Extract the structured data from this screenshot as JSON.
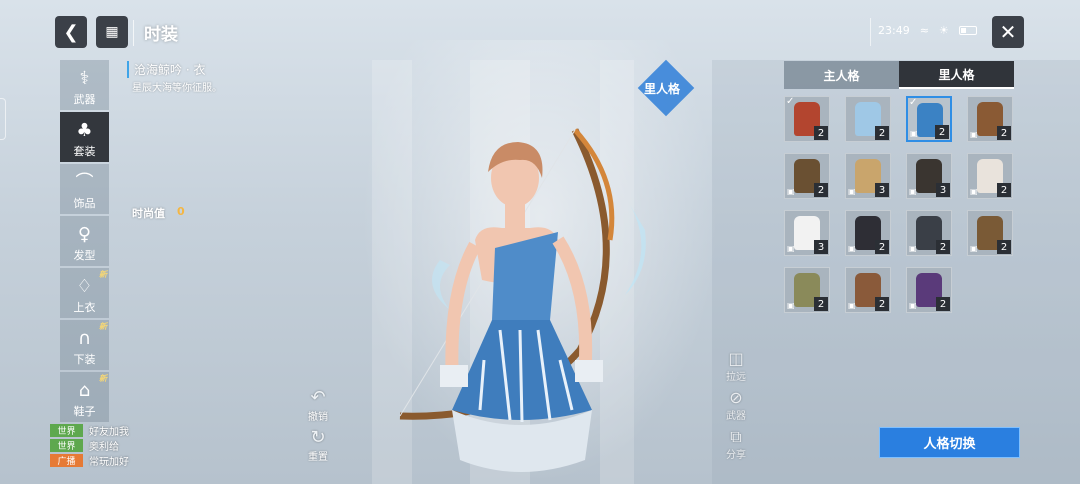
{
  "header": {
    "back_icon": "back-arrow-icon",
    "menu_icon": "grid-menu-icon",
    "title": "时装",
    "time": "23:49",
    "close_icon": "close-x-icon"
  },
  "sidebar": {
    "items": [
      {
        "label": "武器",
        "icon": "weapon-icon",
        "new": false,
        "active": false
      },
      {
        "label": "套装",
        "icon": "outfit-icon",
        "new": false,
        "active": true
      },
      {
        "label": "饰品",
        "icon": "hat-icon",
        "new": false,
        "active": false
      },
      {
        "label": "发型",
        "icon": "hair-icon",
        "new": false,
        "active": false
      },
      {
        "label": "上衣",
        "icon": "top-icon",
        "new": true,
        "active": false
      },
      {
        "label": "下装",
        "icon": "pants-icon",
        "new": true,
        "active": false
      },
      {
        "label": "鞋子",
        "icon": "shoes-icon",
        "new": true,
        "active": false
      }
    ],
    "new_label": "新"
  },
  "item": {
    "name": "沧海鲸吟 · 衣",
    "desc": "星辰大海等你征服。",
    "fashion_label": "时尚值",
    "fashion_value": "0"
  },
  "persona_tag": "里人格",
  "actions": {
    "undo": "撤销",
    "reset": "重置"
  },
  "tools": {
    "zoom": "拉远",
    "weapon": "武器",
    "share": "分享"
  },
  "panel": {
    "tabs": [
      "主人格",
      "里人格"
    ],
    "active_tab": 1,
    "items": [
      {
        "count": "2",
        "color": "#b3452f",
        "locked": false,
        "checked": true,
        "selected": false
      },
      {
        "count": "2",
        "color": "#9fc8e6",
        "locked": false,
        "checked": false,
        "selected": false
      },
      {
        "count": "2",
        "color": "#3b82c4",
        "locked": true,
        "checked": true,
        "selected": true
      },
      {
        "count": "2",
        "color": "#8a5a34",
        "locked": true,
        "checked": false,
        "selected": false
      },
      {
        "count": "2",
        "color": "#6a5032",
        "locked": true,
        "checked": false,
        "selected": false
      },
      {
        "count": "3",
        "color": "#c9a56c",
        "locked": true,
        "checked": false,
        "selected": false
      },
      {
        "count": "3",
        "color": "#3a3530",
        "locked": true,
        "checked": false,
        "selected": false
      },
      {
        "count": "2",
        "color": "#e9e3dc",
        "locked": true,
        "checked": false,
        "selected": false
      },
      {
        "count": "3",
        "color": "#f2f2f2",
        "locked": true,
        "checked": false,
        "selected": false
      },
      {
        "count": "2",
        "color": "#2e2e35",
        "locked": true,
        "checked": false,
        "selected": false
      },
      {
        "count": "2",
        "color": "#3a3f47",
        "locked": true,
        "checked": false,
        "selected": false
      },
      {
        "count": "2",
        "color": "#7a5a36",
        "locked": true,
        "checked": false,
        "selected": false
      },
      {
        "count": "2",
        "color": "#8a8a5a",
        "locked": true,
        "checked": false,
        "selected": false
      },
      {
        "count": "2",
        "color": "#8a5a3a",
        "locked": true,
        "checked": false,
        "selected": false
      },
      {
        "count": "2",
        "color": "#5a3a7a",
        "locked": true,
        "checked": false,
        "selected": false
      }
    ],
    "switch_label": "人格切换"
  },
  "chat": [
    {
      "channel": "世界",
      "type": "world",
      "name": "",
      "msg": "好友加我"
    },
    {
      "channel": "世界",
      "type": "world",
      "name": "",
      "msg": "奥利给"
    },
    {
      "channel": "广播",
      "type": "broadcast",
      "name": "",
      "msg": "常玩加好"
    }
  ],
  "colors": {
    "accent": "#2a7fe0",
    "fashion_value": "#f5b642",
    "world_channel": "#5ea84e",
    "broadcast_channel": "#e67a35"
  }
}
